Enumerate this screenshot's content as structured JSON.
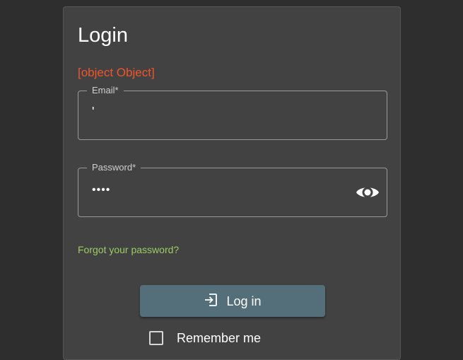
{
  "login": {
    "title": "Login",
    "error_message": "[object Object]",
    "email": {
      "label": "Email*",
      "value": "'"
    },
    "password": {
      "label": "Password*",
      "value": "••••",
      "visibility_icon": "eye-icon"
    },
    "forgot_password_link": "Forgot your password?",
    "login_button": {
      "label": "Log in",
      "icon": "login-icon"
    },
    "remember_me": {
      "label": "Remember me",
      "checked": false
    }
  },
  "colors": {
    "background": "#2e2e2e",
    "card": "#424242",
    "error": "#f0552d",
    "link": "#9ccc65",
    "primary_button": "#546e7a"
  }
}
